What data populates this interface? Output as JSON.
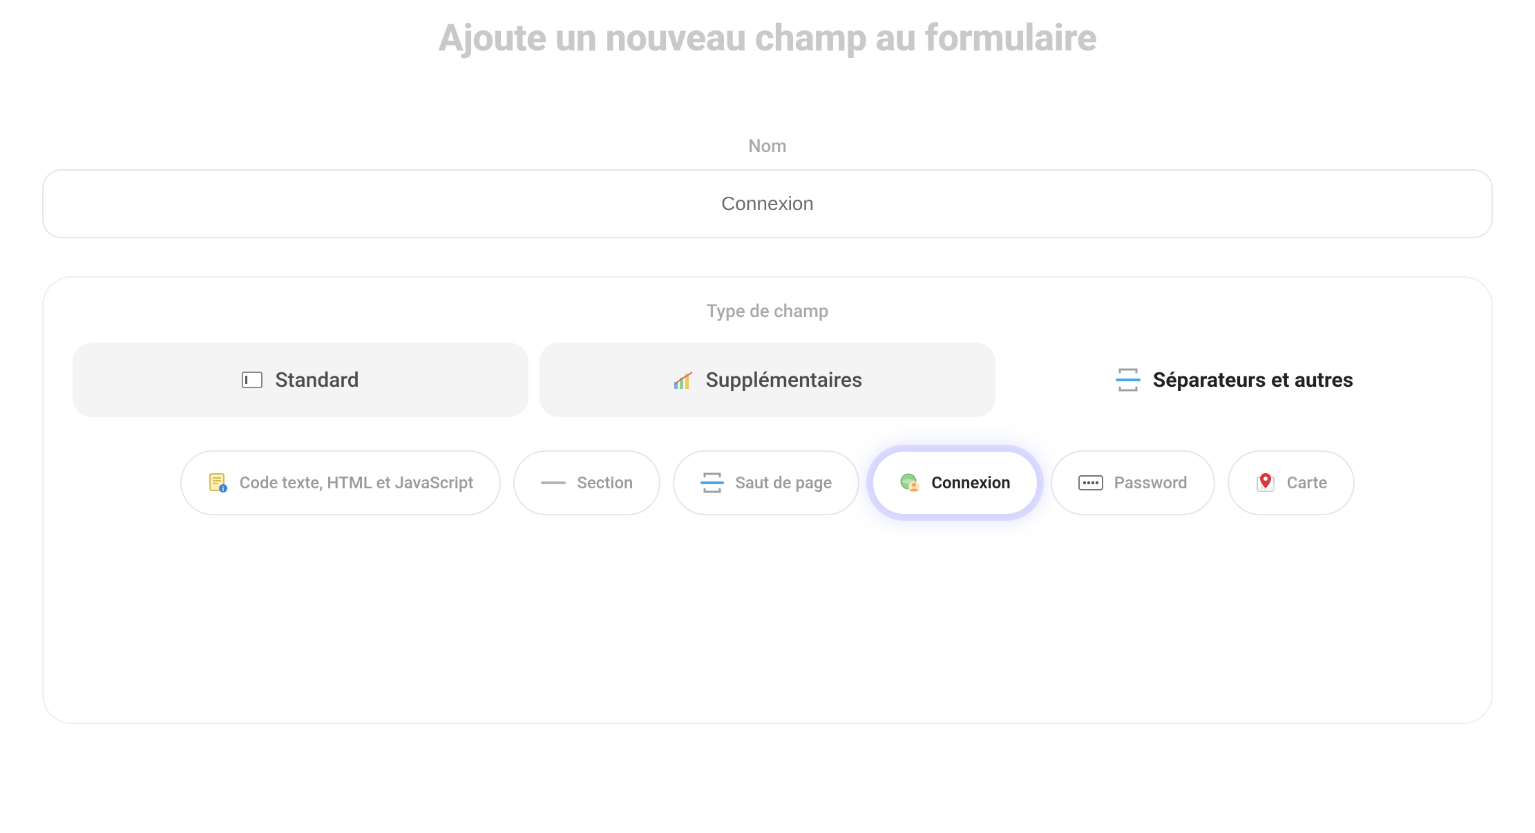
{
  "title": "Ajoute un nouveau champ au formulaire",
  "name_field": {
    "label": "Nom",
    "value": "Connexion"
  },
  "type_section": {
    "label": "Type de champ",
    "tabs": [
      {
        "id": "standard",
        "label": "Standard",
        "active": false
      },
      {
        "id": "extra",
        "label": "Supplémentaires",
        "active": false
      },
      {
        "id": "separators",
        "label": "Séparateurs et autres",
        "active": true
      }
    ],
    "options": [
      {
        "id": "code",
        "label": "Code texte, HTML et JavaScript",
        "selected": false
      },
      {
        "id": "section",
        "label": "Section",
        "selected": false
      },
      {
        "id": "pagebreak",
        "label": "Saut de page",
        "selected": false
      },
      {
        "id": "connexion",
        "label": "Connexion",
        "selected": true
      },
      {
        "id": "password",
        "label": "Password",
        "selected": false
      },
      {
        "id": "carte",
        "label": "Carte",
        "selected": false
      }
    ]
  }
}
